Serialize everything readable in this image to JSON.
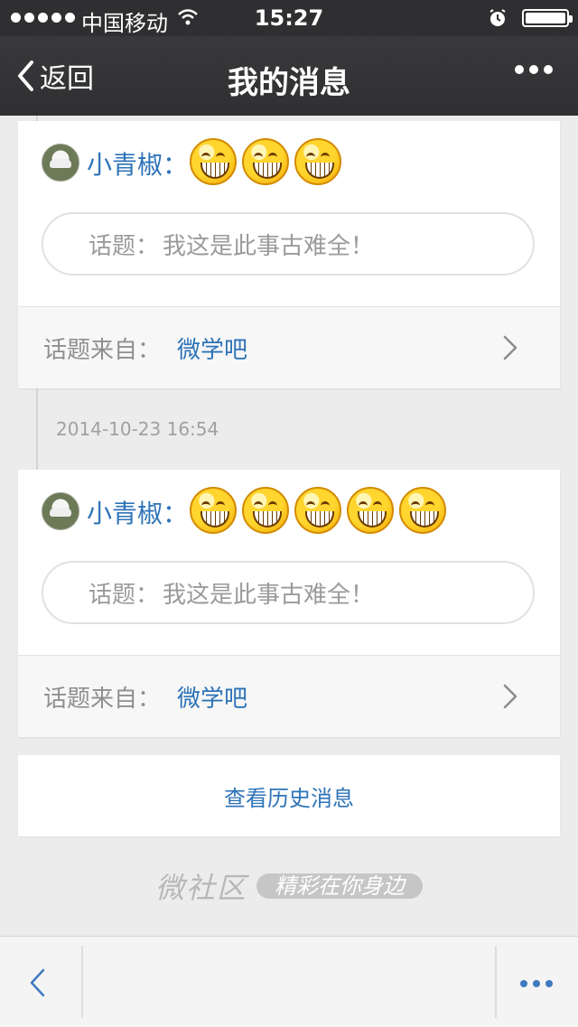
{
  "status_bar": {
    "carrier": "中国移动",
    "time": "15:27",
    "signal_icon": "signal-dots-icon",
    "wifi_icon": "wifi-icon",
    "alarm_icon": "alarm-icon",
    "battery_icon": "battery-icon"
  },
  "nav": {
    "back_label": "返回",
    "title": "我的消息",
    "more_icon": "more-icon"
  },
  "messages": [
    {
      "username": "小青椒：",
      "emoji_count": 3,
      "topic_label": "话题：",
      "topic_text": "我这是此事古难全！",
      "source_label": "话题来自：",
      "source_link": "微学吧"
    },
    {
      "date": "2014-10-23 16:54",
      "username": "小青椒：",
      "emoji_count": 5,
      "topic_label": "话题：",
      "topic_text": "我这是此事古难全！",
      "source_label": "话题来自：",
      "source_link": "微学吧"
    }
  ],
  "history_button": "查看历史消息",
  "branding": {
    "main": "微社区",
    "tagline": "精彩在你身边"
  },
  "toolbar": {
    "back_icon": "chevron-left-icon",
    "more_icon": "more-icon"
  },
  "colors": {
    "accent": "#2d73b8",
    "dark_bar": "#303032",
    "background": "#ececec"
  }
}
